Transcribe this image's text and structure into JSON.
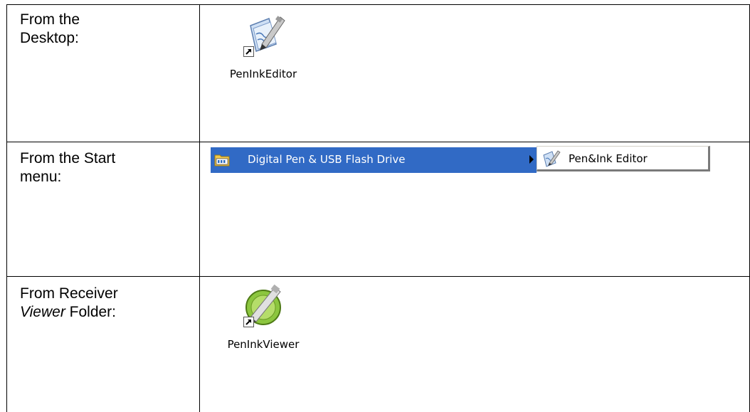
{
  "rows": [
    {
      "label_lines": [
        "From the",
        "Desktop:"
      ]
    },
    {
      "label_lines": [
        "From the Start",
        "menu:"
      ]
    },
    {
      "label_parts": [
        "From Receiver",
        "Viewer",
        " Folder:"
      ]
    }
  ],
  "desktop_icon": {
    "caption": "PenInkEditor",
    "icon": "pen-ink-editor-icon"
  },
  "start_menu": {
    "folder_label": "Digital Pen & USB Flash Drive",
    "folder_icon": "program-group-folder-icon",
    "submenu_item_label": "Pen&Ink Editor",
    "submenu_item_icon": "pen-ink-editor-icon",
    "highlight_color": "#316ac5"
  },
  "viewer_icon": {
    "caption": "PenInkViewer",
    "icon": "pen-ink-viewer-icon"
  }
}
